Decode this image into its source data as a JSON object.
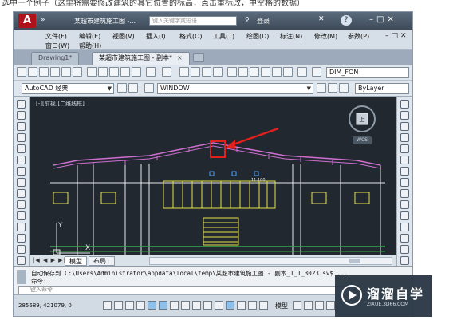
{
  "caption": "选中一个例子（这里将需要修改建筑的其它位置的标高，点击重标改，中空格的数据）",
  "app": {
    "logo": "A",
    "title": "某超市建筑施工图 -...",
    "search_placeholder": "键入关键字或短语",
    "login": "登录",
    "help": "?"
  },
  "menu": {
    "row1": [
      "文件(F)",
      "编辑(E)",
      "视图(V)",
      "插入(I)",
      "格式(O)",
      "工具(T)",
      "绘图(D)",
      "标注(N)",
      "修改(M)",
      "参数(P)"
    ],
    "row2": [
      "窗口(W)",
      "帮助(H)"
    ]
  },
  "tabs": [
    {
      "label": "Drawing1*",
      "active": false
    },
    {
      "label": "某超市建筑施工图 - 副本*",
      "active": true
    }
  ],
  "toolbar": {
    "workspace": "AutoCAD 经典",
    "layer": "WINDOW",
    "linetype": "ByLayer",
    "dim_style": "DIM_FON"
  },
  "canvas": {
    "viewport_label": "[-][前视][二维线框]",
    "wcs": "WCS",
    "compass_label": "上",
    "elevation_label": "11.100",
    "axis_y": "Y",
    "axis_x": "X",
    "colors": {
      "background": "#212830",
      "roof": "#d06fd0",
      "window": "#e6e04a",
      "ground": "#2fb04a",
      "marker": "#e0211d"
    }
  },
  "layout_tabs": [
    "模型",
    "布局1"
  ],
  "command": {
    "history": "自动保存到 C:\\Users\\Administrator\\appdata\\local\\temp\\某超市建筑施工图 - 副本_1_1_3023.sv$ ...",
    "prompt": "命令:",
    "input_placeholder": "键入命令"
  },
  "status": {
    "coords": "285689, 421079, 0",
    "model_label": "模型"
  },
  "watermark": {
    "title": "溜溜自学",
    "url": "ZIXUE.3D66.COM"
  }
}
